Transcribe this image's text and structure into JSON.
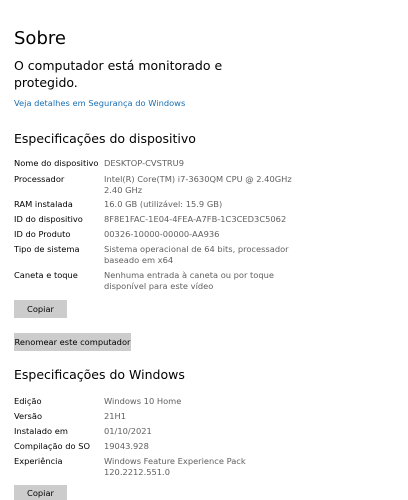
{
  "page": {
    "title": "Sobre",
    "status": "O computador está monitorado e protegido.",
    "security_link": "Veja detalhes em Segurança do Windows"
  },
  "device_specs": {
    "heading": "Especificações do dispositivo",
    "rows": [
      {
        "label": "Nome do dispositivo",
        "value": "DESKTOP-CVSTRU9"
      },
      {
        "label": "Processador",
        "value": "Intel(R) Core(TM) i7-3630QM CPU @ 2.40GHz 2.40 GHz"
      },
      {
        "label": "RAM instalada",
        "value": "16.0 GB (utilizável: 15.9 GB)"
      },
      {
        "label": "ID do dispositivo",
        "value": "8F8E1FAC-1E04-4FEA-A7FB-1C3CED3C5062"
      },
      {
        "label": "ID do Produto",
        "value": "00326-10000-00000-AA936"
      },
      {
        "label": "Tipo de sistema",
        "value": "Sistema operacional de 64 bits, processador baseado em x64"
      },
      {
        "label": "Caneta e toque",
        "value": "Nenhuma entrada à caneta ou por toque disponível para este vídeo"
      }
    ],
    "copy_label": "Copiar",
    "rename_label": "Renomear este computador"
  },
  "windows_specs": {
    "heading": "Especificações do Windows",
    "rows": [
      {
        "label": "Edição",
        "value": "Windows 10 Home"
      },
      {
        "label": "Versão",
        "value": "21H1"
      },
      {
        "label": "Instalado em",
        "value": "01/10/2021"
      },
      {
        "label": "Compilação do SO",
        "value": "19043.928"
      },
      {
        "label": "Experiência",
        "value": "Windows Feature Experience Pack 120.2212.551.0"
      }
    ],
    "copy_label": "Copiar"
  }
}
